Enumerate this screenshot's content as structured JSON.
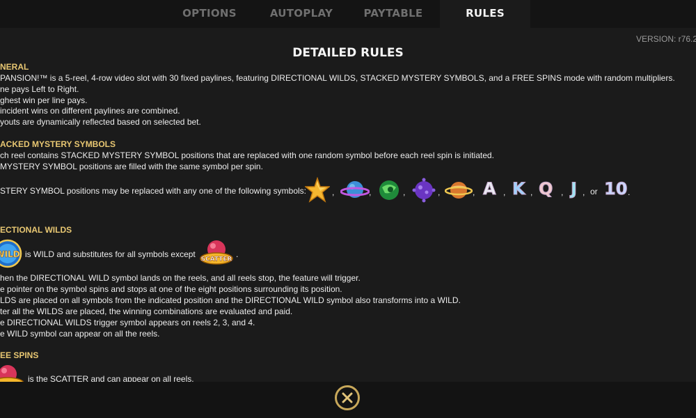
{
  "tabs": [
    "OPTIONS",
    "AUTOPLAY",
    "PAYTABLE",
    "RULES"
  ],
  "version": "VERSION: r76.2",
  "title": "DETAILED RULES",
  "general": {
    "heading": "NERAL",
    "lines": [
      "PANSION!™ is a 5-reel, 4-row video slot with 30 fixed paylines, featuring DIRECTIONAL WILDS, STACKED MYSTERY SYMBOLS, and a FREE SPINS mode with random multipliers.",
      "ne pays Left to Right.",
      "ghest win per line pays.",
      "incident wins on different paylines are combined.",
      "youts are dynamically reflected based on selected bet."
    ]
  },
  "mystery": {
    "heading": "ACKED MYSTERY SYMBOLS",
    "lines": [
      "ch reel contains STACKED MYSTERY SYMBOL positions that are replaced with one random symbol before each reel spin is initiated.",
      "MYSTERY SYMBOL positions are filled with the same symbol per spin.",
      "STERY SYMBOL positions may be replaced with any one of the following symbols:"
    ],
    "symbols": [
      "star-icon",
      "blue-planet-icon",
      "green-planet-icon",
      "purple-planet-icon",
      "ringed-planet-icon",
      "A",
      "K",
      "Q",
      "J",
      "10"
    ],
    "separator": ",",
    "or_word": "or",
    "end": "."
  },
  "directional": {
    "heading": "ECTIONAL WILDS",
    "wild_label": "WILD",
    "scatter_label": "SCATTER",
    "wild_text": "is WILD and substitutes for all symbols except",
    "wild_end": ".",
    "lines": [
      "hen the DIRECTIONAL WILD symbol lands on the reels, and all reels stop, the feature will trigger.",
      "e pointer on the symbol spins and stops at one of the eight positions surrounding its position.",
      "LDS are placed on all symbols from the indicated position and the DIRECTIONAL WILD symbol also transforms into a WILD.",
      "ter all the WILDS are placed, the winning combinations are evaluated and paid.",
      "e DIRECTIONAL WILDS trigger symbol appears on reels 2, 3, and 4.",
      "e WILD symbol can appear on all the reels."
    ]
  },
  "freespins": {
    "heading": "EE SPINS",
    "scatter_text": "is the SCATTER and can appear on all reels."
  },
  "colors": {
    "accent": "#e8c772",
    "background": "#1b1b1b",
    "tabbar": "#141414",
    "close_ring": "#c8a85a"
  }
}
